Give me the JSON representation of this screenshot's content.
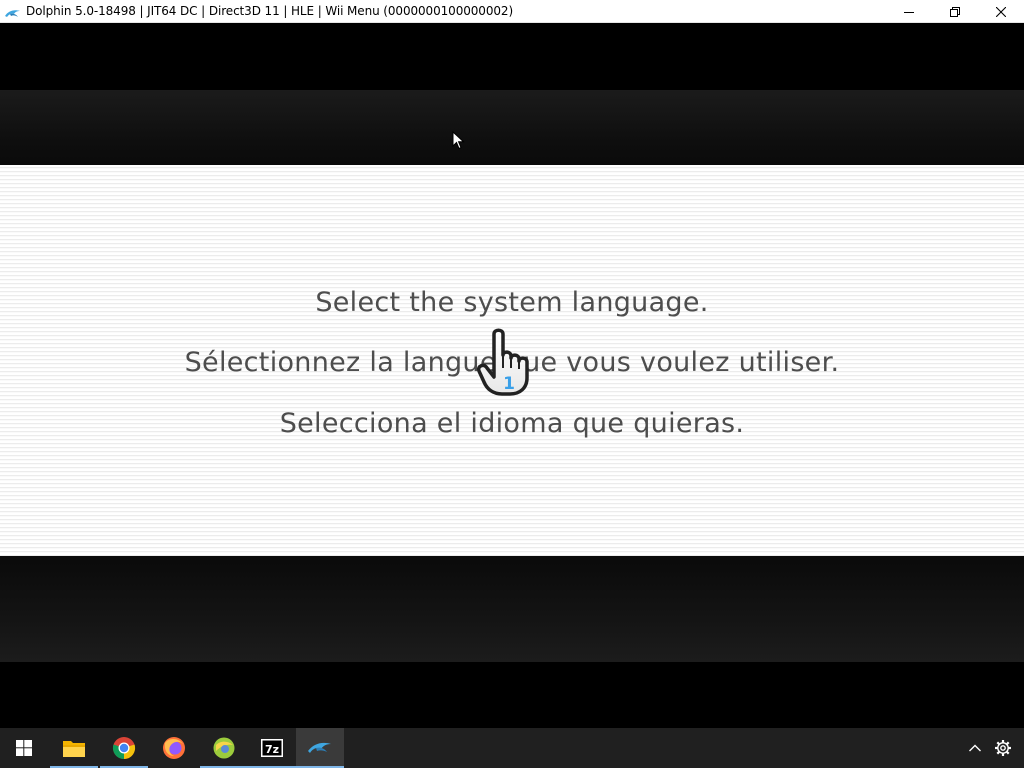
{
  "window": {
    "title": "Dolphin 5.0-18498 | JIT64 DC | Direct3D 11 | HLE | Wii Menu (0000000100000002)",
    "app_icon": "dolphin-icon",
    "controls": [
      "minimize-icon",
      "restore-icon",
      "close-icon"
    ]
  },
  "game": {
    "messages": [
      "Select the system language.",
      "Sélectionnez la langue que vous voulez utiliser.",
      "Selecciona el idioma que quieras."
    ],
    "pointer": {
      "icon": "wii-hand-pointer-icon",
      "player_number": "1"
    }
  },
  "taskbar": {
    "start_icon": "windows-start-icon",
    "pinned": [
      {
        "name": "file-explorer-icon",
        "running": true
      },
      {
        "name": "chrome-icon",
        "running": true
      },
      {
        "name": "firefox-icon",
        "running": false
      },
      {
        "name": "app-globe-icon",
        "running": true
      },
      {
        "name": "7zip-icon",
        "running": true,
        "label": "7z"
      },
      {
        "name": "dolphin-icon",
        "running": true,
        "active": true
      }
    ],
    "tray": [
      "chevron-up-icon",
      "gear-icon"
    ]
  },
  "colors": {
    "panel_text": "#4d4d4d",
    "taskbar_bg": "#202020",
    "running_indicator": "#7fb6e8",
    "dolphin_blue": "#3fa6e0"
  }
}
